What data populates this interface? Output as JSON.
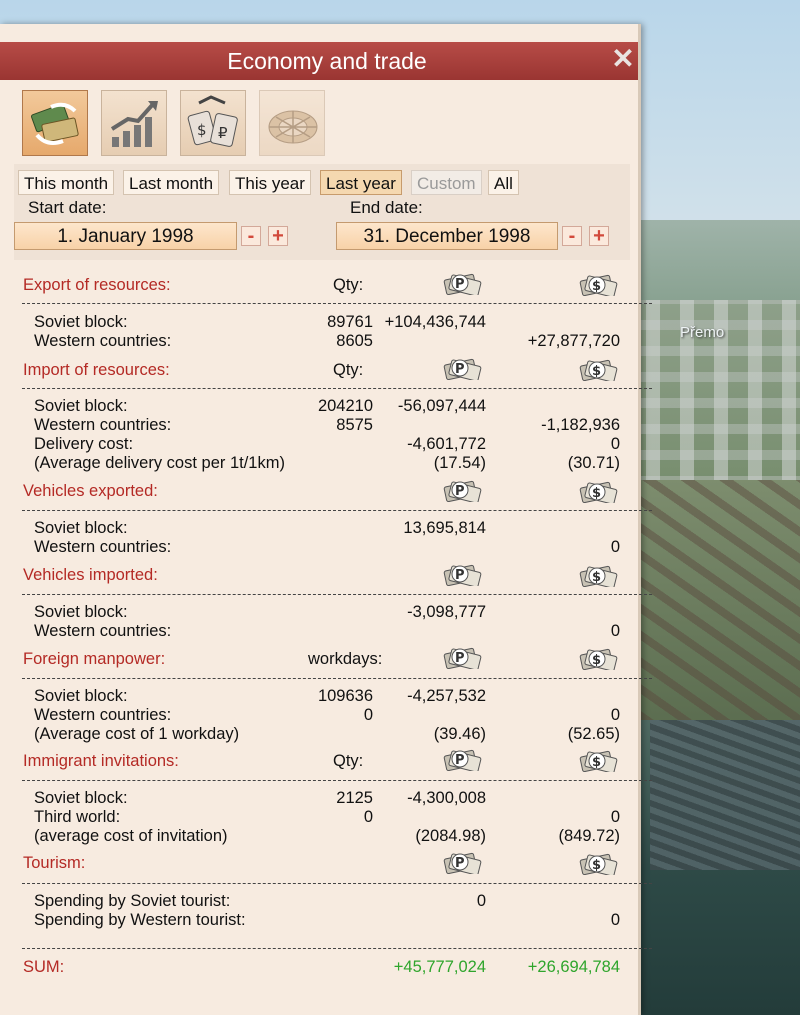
{
  "window": {
    "title": "Economy and trade",
    "close": "✕"
  },
  "city_label": "Přemo",
  "toolbar": [
    {
      "name": "trade-icon",
      "active": true
    },
    {
      "name": "growth-chart-icon",
      "active": false
    },
    {
      "name": "price-tags-icon",
      "active": false
    },
    {
      "name": "roulette-icon",
      "active": false
    }
  ],
  "periods": [
    "This month",
    "Last month",
    "This year",
    "Last year",
    "Custom",
    "All"
  ],
  "selected_period": "Last year",
  "disabled_period": "Custom",
  "dates": {
    "start_label": "Start date:",
    "start_value": "1. January 1998",
    "end_label": "End date:",
    "end_value": "31. December 1998",
    "minus": "-",
    "plus": "+"
  },
  "currency_icons": {
    "rubles": "ruble-banknotes-icon",
    "dollars": "dollar-banknotes-icon"
  },
  "sections": {
    "export": {
      "title": "Export of resources:",
      "qty": "Qty:",
      "rows": [
        {
          "label": "Soviet block:",
          "qty": "89761",
          "rub": "+104,436,744",
          "usd": ""
        },
        {
          "label": "Western countries:",
          "qty": "8605",
          "rub": "",
          "usd": "+27,877,720"
        }
      ]
    },
    "import": {
      "title": "Import of resources:",
      "qty": "Qty:",
      "rows": [
        {
          "label": "Soviet block:",
          "qty": "204210",
          "rub": "-56,097,444",
          "usd": ""
        },
        {
          "label": "Western countries:",
          "qty": "8575",
          "rub": "",
          "usd": "-1,182,936"
        },
        {
          "label": "Delivery cost:",
          "qty": "",
          "rub": "-4,601,772",
          "usd": "0"
        },
        {
          "label": "(Average delivery cost per 1t/1km)",
          "qty": "",
          "rub": "(17.54)",
          "usd": "(30.71)"
        }
      ]
    },
    "veh_exp": {
      "title": "Vehicles exported:",
      "rows": [
        {
          "label": "Soviet block:",
          "rub": "13,695,814",
          "usd": ""
        },
        {
          "label": "Western countries:",
          "rub": "",
          "usd": "0"
        }
      ]
    },
    "veh_imp": {
      "title": "Vehicles imported:",
      "rows": [
        {
          "label": "Soviet block:",
          "rub": "-3,098,777",
          "usd": ""
        },
        {
          "label": "Western countries:",
          "rub": "",
          "usd": "0"
        }
      ]
    },
    "manpower": {
      "title": "Foreign manpower:",
      "qty": "workdays:",
      "rows": [
        {
          "label": "Soviet block:",
          "qty": "109636",
          "rub": "-4,257,532",
          "usd": ""
        },
        {
          "label": "Western countries:",
          "qty": "0",
          "rub": "",
          "usd": "0"
        },
        {
          "label": "(Average cost of 1 workday)",
          "qty": "",
          "rub": "(39.46)",
          "usd": "(52.65)"
        }
      ]
    },
    "immigrants": {
      "title": "Immigrant invitations:",
      "qty": "Qty:",
      "rows": [
        {
          "label": "Soviet block:",
          "qty": "2125",
          "rub": "-4,300,008",
          "usd": ""
        },
        {
          "label": "Third world:",
          "qty": "0",
          "rub": "",
          "usd": "0"
        },
        {
          "label": "(average cost of invitation)",
          "qty": "",
          "rub": "(2084.98)",
          "usd": "(849.72)"
        }
      ]
    },
    "tourism": {
      "title": "Tourism:",
      "rows": [
        {
          "label": "Spending by Soviet tourist:",
          "rub": "0",
          "usd": ""
        },
        {
          "label": "Spending by Western tourist:",
          "rub": "",
          "usd": "0"
        }
      ]
    }
  },
  "sum": {
    "label": "SUM:",
    "rub": "+45,777,024",
    "usd": "+26,694,784"
  },
  "colors": {
    "title_bar": "#a63b37",
    "section_title": "#b42a25",
    "positive_sum": "#2fa52c",
    "panel": "#f7ebe0"
  }
}
